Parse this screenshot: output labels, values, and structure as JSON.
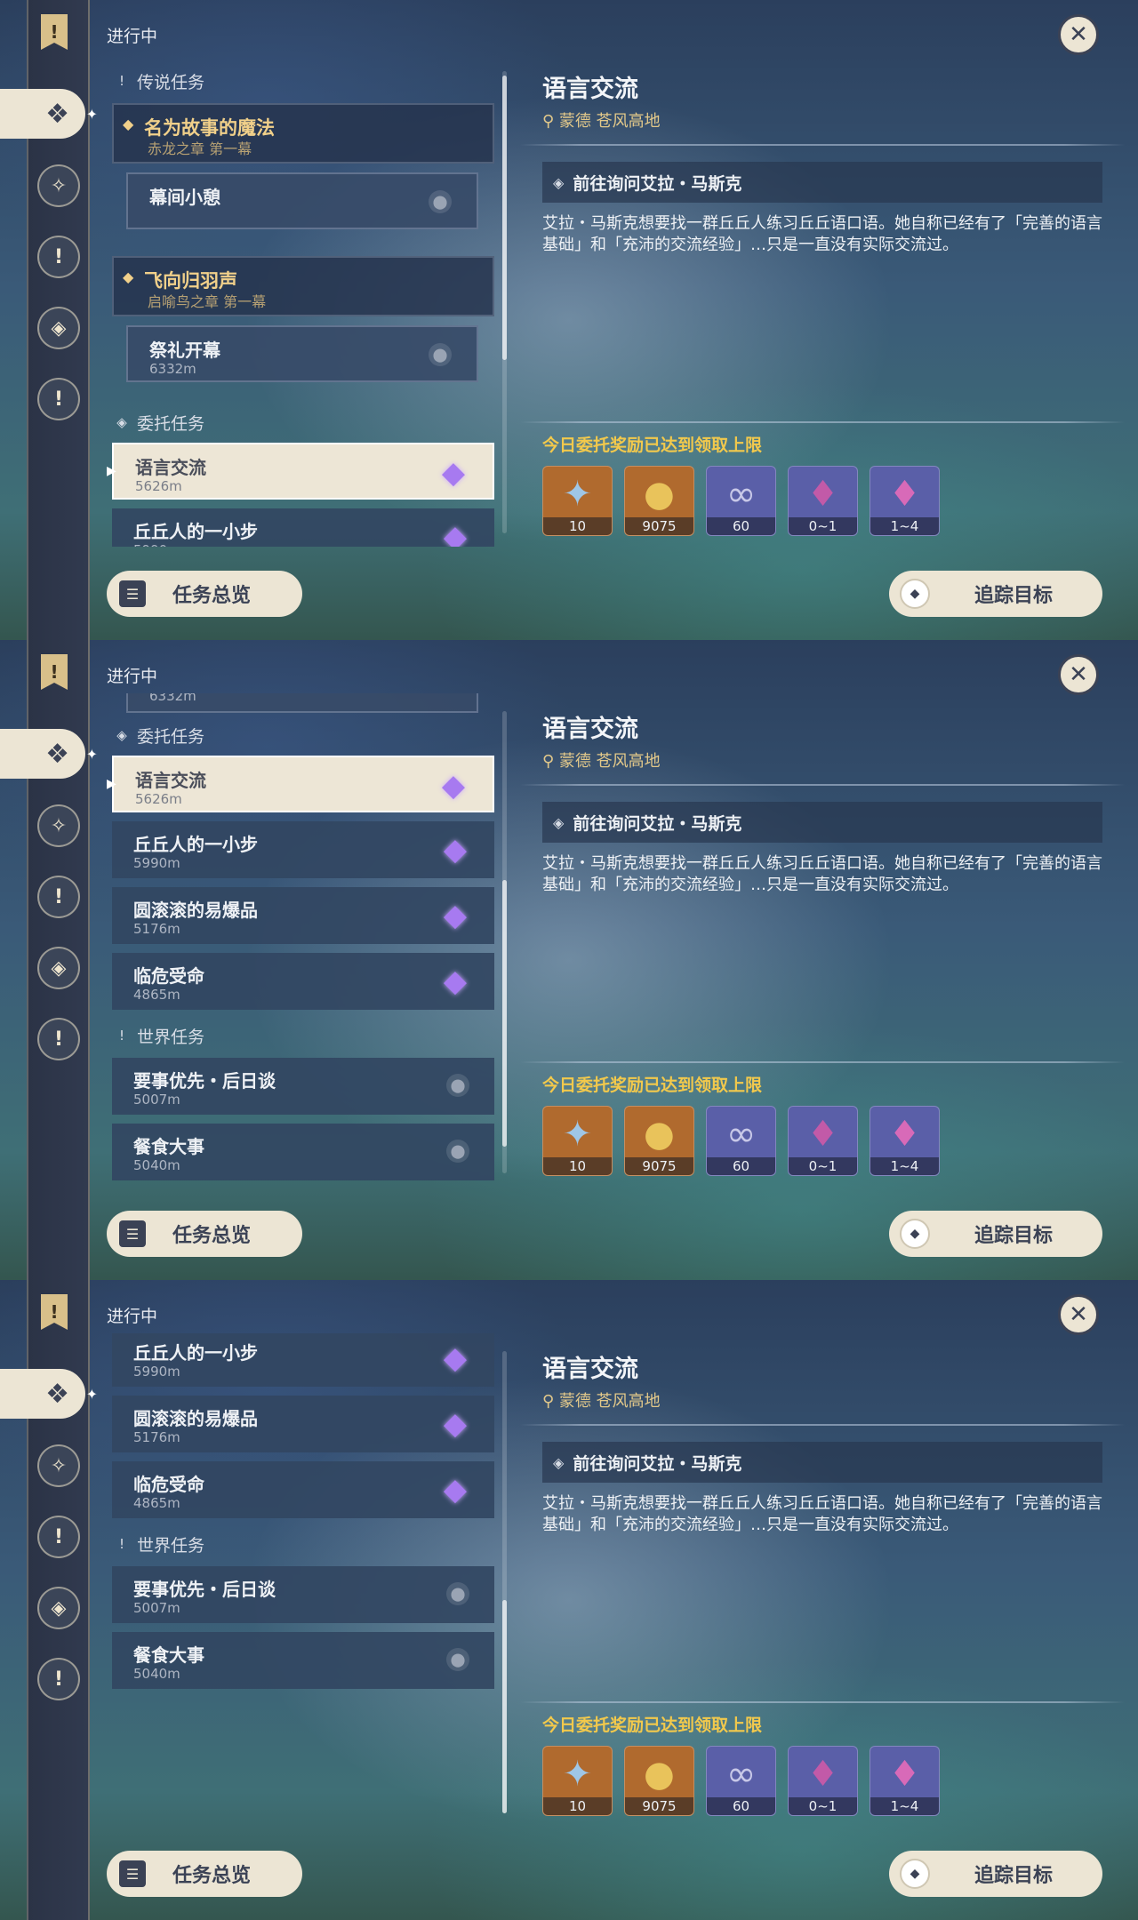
{
  "ui": {
    "status_label": "进行中",
    "close_icon": "close-icon",
    "overview_label": "任务总览",
    "track_label": "追踪目标"
  },
  "detail": {
    "title": "语言交流",
    "location": "蒙德 苍风高地",
    "objective": "前往询问艾拉・马斯克",
    "description": "艾拉・马斯克想要找一群丘丘人练习丘丘语口语。她自称已经有了「完善的语言基础」和「充沛的交流经验」…只是一直没有实际交流过。",
    "reward_note": "今日委托奖励已达到领取上限",
    "rewards": [
      {
        "icon": "adventure-exp-icon",
        "count": "10",
        "bg": "#b06a2e"
      },
      {
        "icon": "mora-icon",
        "count": "9075",
        "bg": "#b06a2e"
      },
      {
        "icon": "friendship-exp-icon",
        "count": "60",
        "bg": "#5a5fa8"
      },
      {
        "icon": "crystal-chunk-icon",
        "count": "0~1",
        "bg": "#5a5fa8"
      },
      {
        "icon": "crystal-cluster-icon",
        "count": "1~4",
        "bg": "#5a5fa8"
      }
    ]
  },
  "categories": {
    "legend": "传说任务",
    "commission": "委托任务",
    "world": "世界任务"
  },
  "legend_quests": [
    {
      "title": "名为故事的魔法",
      "subtitle": "赤龙之章 第一幕",
      "sub_title": "幕间小憩",
      "sub_distance": ""
    },
    {
      "title": "飞向归羽声",
      "subtitle": "启喻鸟之章 第一幕",
      "sub_title": "祭礼开幕",
      "sub_distance": "6332m"
    }
  ],
  "commissions": [
    {
      "title": "语言交流",
      "distance": "5626m"
    },
    {
      "title": "丘丘人的一小步",
      "distance": "5990m"
    },
    {
      "title": "圆滚滚的易爆品",
      "distance": "5176m"
    },
    {
      "title": "临危受命",
      "distance": "4865m"
    }
  ],
  "world_quests": [
    {
      "title": "要事优先・后日谈",
      "distance": "5007m"
    },
    {
      "title": "餐食大事",
      "distance": "5040m"
    }
  ]
}
